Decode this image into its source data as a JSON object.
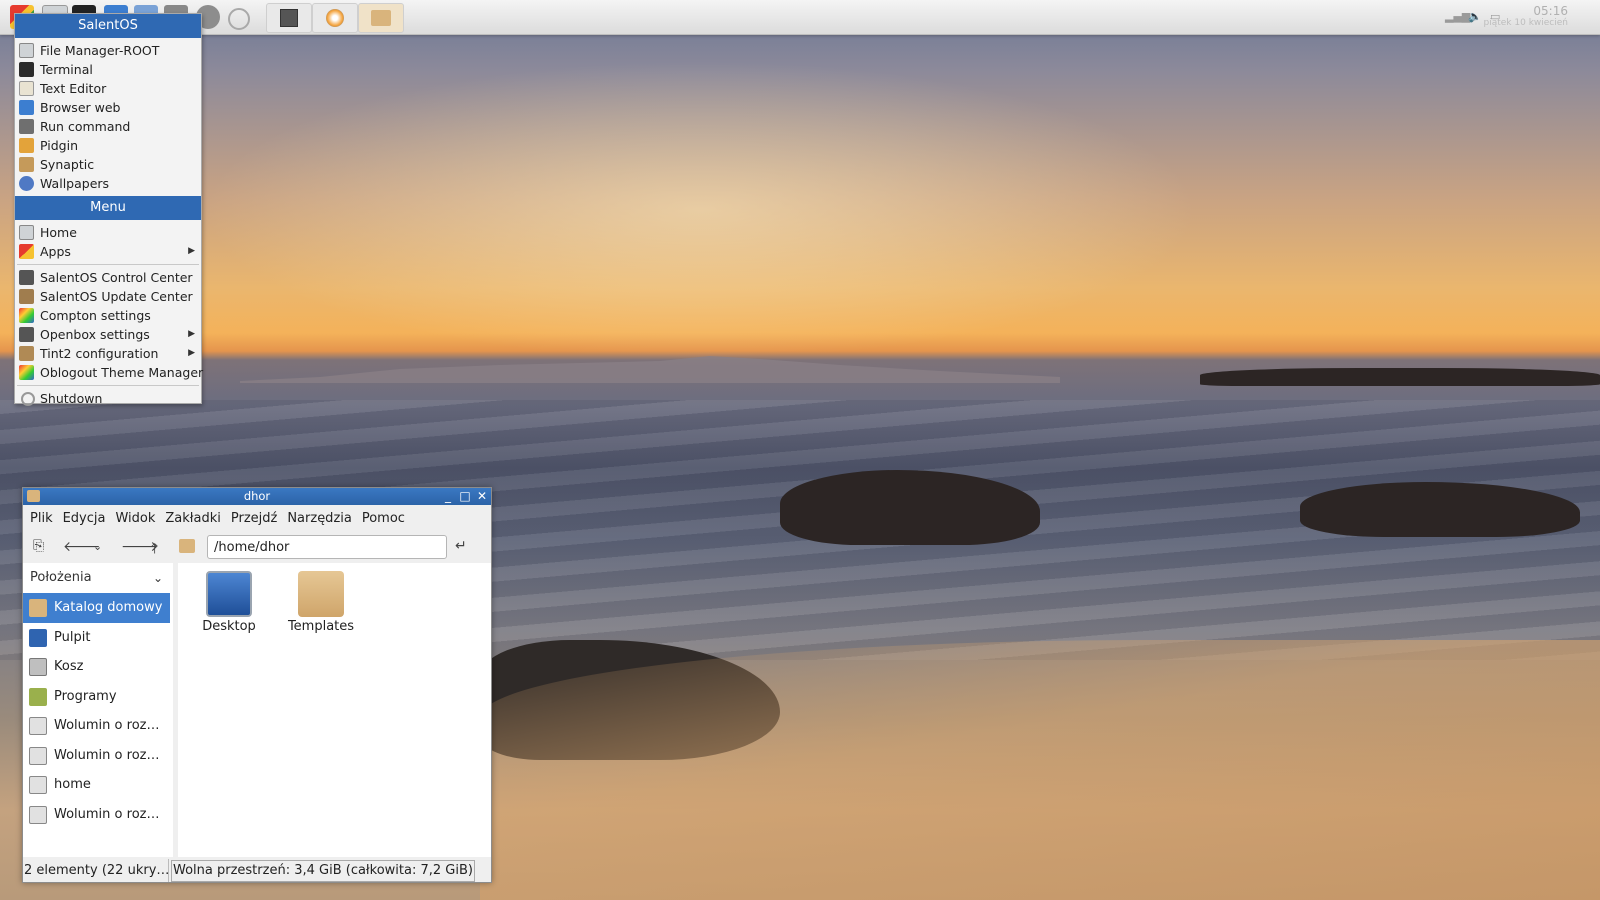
{
  "panel": {
    "clock_time": "05:16",
    "clock_date": "piątek 10 kwiecień"
  },
  "menu": {
    "header": "SalentOS",
    "quick_items": [
      {
        "label": "File Manager-ROOT",
        "icon": "file-manager-icon"
      },
      {
        "label": "Terminal",
        "icon": "terminal-icon"
      },
      {
        "label": "Text Editor",
        "icon": "text-editor-icon"
      },
      {
        "label": "Browser web",
        "icon": "browser-icon"
      },
      {
        "label": "Run command",
        "icon": "run-command-icon"
      },
      {
        "label": "Pidgin",
        "icon": "pidgin-icon"
      },
      {
        "label": "Synaptic",
        "icon": "synaptic-icon"
      },
      {
        "label": "Wallpapers",
        "icon": "wallpapers-icon"
      }
    ],
    "section_header": "Menu",
    "home": "Home",
    "apps": "Apps",
    "settings_items": [
      {
        "label": "SalentOS Control Center",
        "submenu": false
      },
      {
        "label": "SalentOS Update Center",
        "submenu": false
      },
      {
        "label": "Compton settings",
        "submenu": false
      },
      {
        "label": "Openbox settings",
        "submenu": true
      },
      {
        "label": "Tint2 configuration",
        "submenu": true
      },
      {
        "label": "Oblogout Theme Manager",
        "submenu": false
      }
    ],
    "shutdown": "Shutdown"
  },
  "window": {
    "title": "dhor",
    "menubar": [
      "Plik",
      "Edycja",
      "Widok",
      "Zakładki",
      "Przejdź",
      "Narzędzia",
      "Pomoc"
    ],
    "path": "/home/dhor",
    "sidebar_title": "Położenia",
    "sidebar_items": [
      {
        "label": "Katalog domowy",
        "selected": true
      },
      {
        "label": "Pulpit",
        "selected": false
      },
      {
        "label": "Kosz",
        "selected": false
      },
      {
        "label": "Programy",
        "selected": false
      },
      {
        "label": "Wolumin o roz…",
        "selected": false
      },
      {
        "label": "Wolumin o roz…",
        "selected": false
      },
      {
        "label": "home",
        "selected": false
      },
      {
        "label": "Wolumin o roz…",
        "selected": false
      }
    ],
    "files": [
      {
        "label": "Desktop"
      },
      {
        "label": "Templates"
      }
    ],
    "status_left": "2 elementy (22 ukry…",
    "status_right": "Wolna przestrzeń: 3,4 GiB (całkowita: 7,2 GiB)"
  },
  "colors": {
    "accent": "#2f69b3",
    "selection": "#3f7fcf"
  }
}
